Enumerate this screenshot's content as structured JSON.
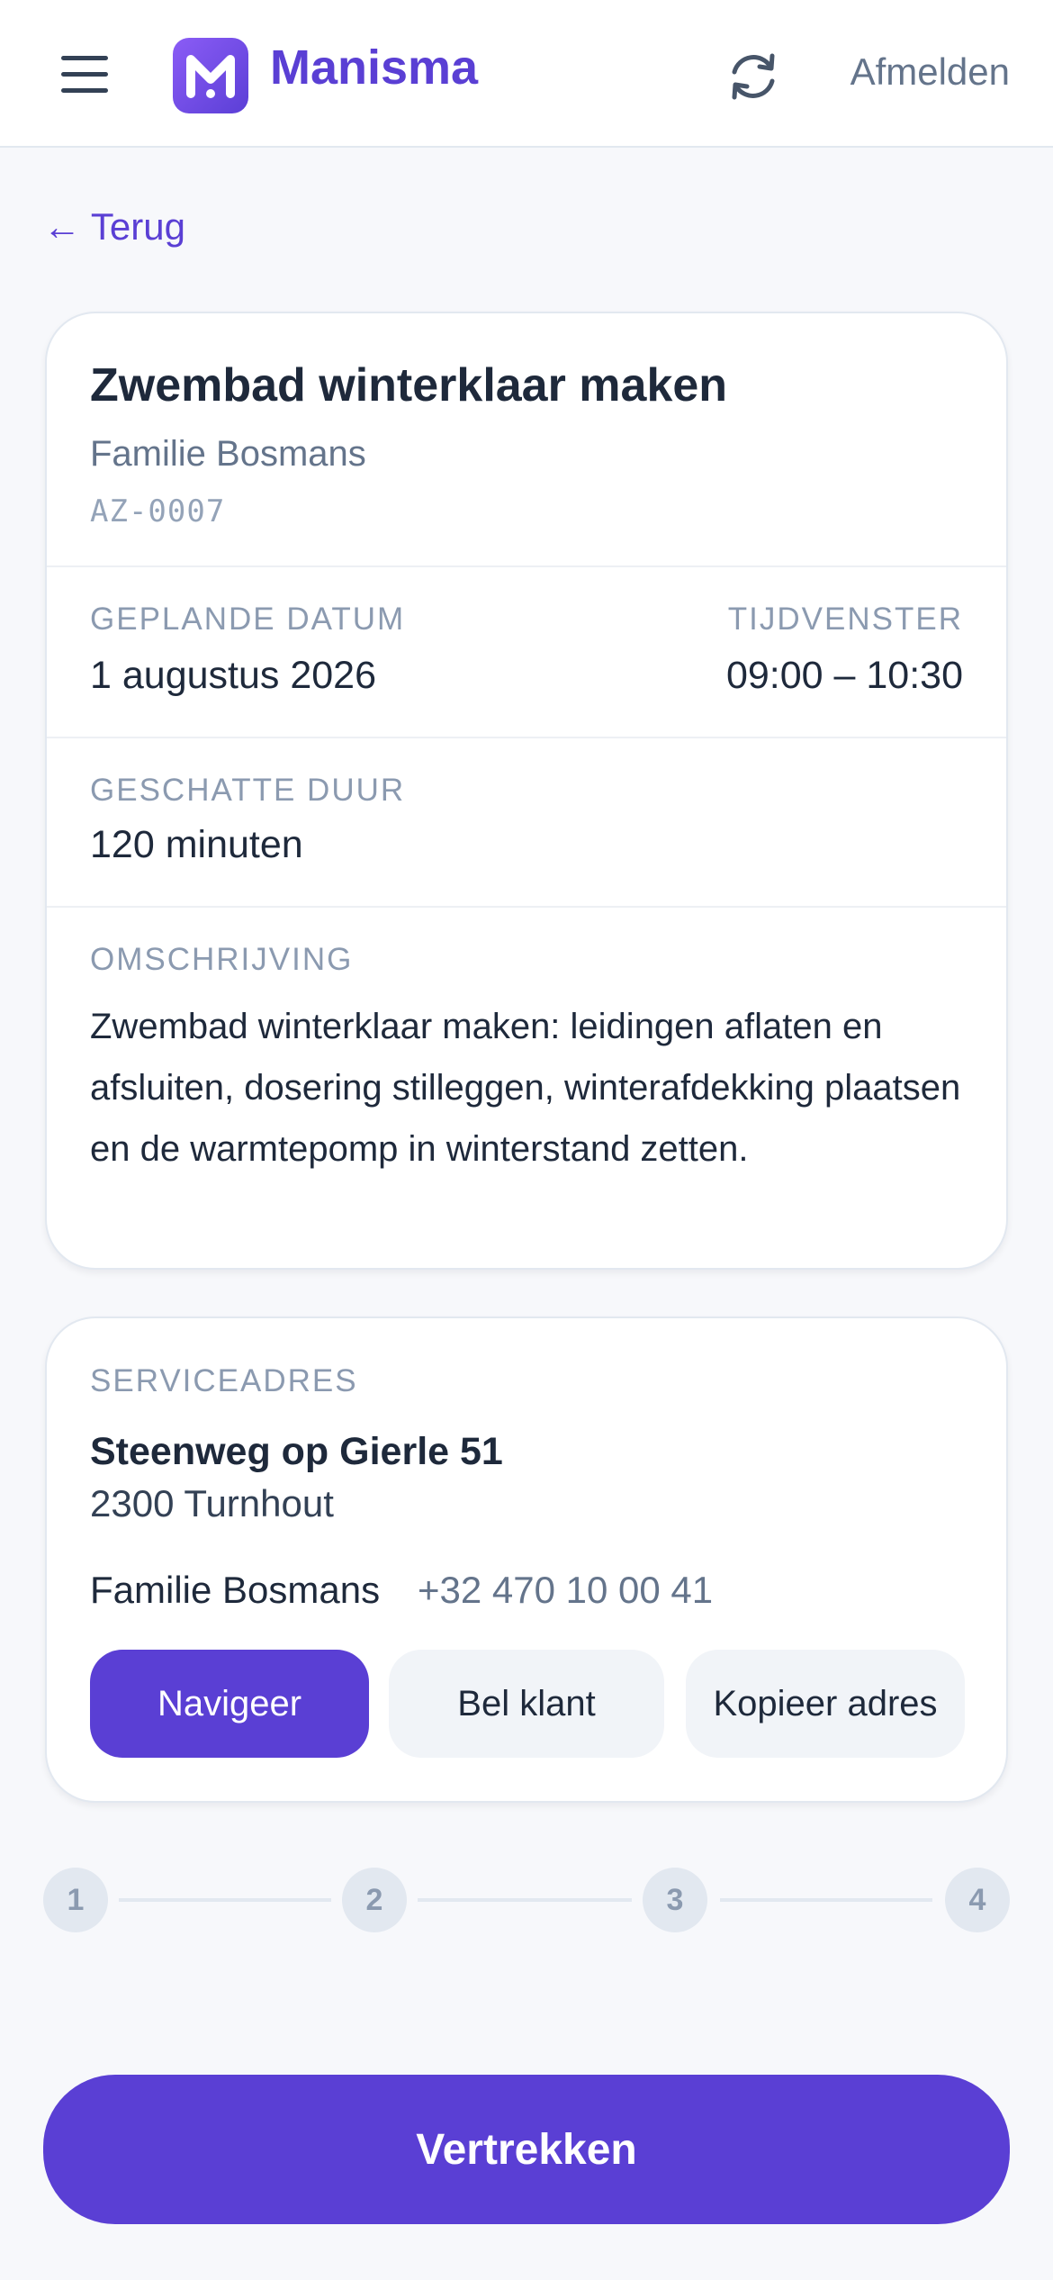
{
  "header": {
    "brand": "Manisma",
    "logout_label": "Afmelden",
    "icons": [
      "menu-icon",
      "logo-icon",
      "refresh-icon"
    ],
    "accent_color": "#5a3fd4"
  },
  "nav": {
    "back_label": "← Terug"
  },
  "job": {
    "title": "Zwembad winterklaar maken",
    "client": "Familie Bosmans",
    "code": "AZ-0007",
    "planned_date_label": "GEPLANDE DATUM",
    "planned_date": "1 augustus 2026",
    "time_window_label": "TIJDVENSTER",
    "time_window": "09:00 – 10:30",
    "duration_label": "GESCHATTE DUUR",
    "duration": "120 minuten",
    "description_label": "OMSCHRIJVING",
    "description": "Zwembad winterklaar maken: leidingen aflaten en afsluiten, dosering stilleggen, winterafdekking plaatsen en de warmtepomp in winterstand zetten."
  },
  "address": {
    "label": "SERVICEADRES",
    "street": "Steenweg op Gierle 51",
    "city": "2300 Turnhout",
    "contact_name": "Familie Bosmans",
    "phone": "+32 470 10 00 41",
    "buttons": {
      "navigate": "Navigeer",
      "call": "Bel klant",
      "copy": "Kopieer adres"
    }
  },
  "steps": [
    "1",
    "2",
    "3",
    "4"
  ],
  "cta": {
    "label": "Vertrekken"
  }
}
